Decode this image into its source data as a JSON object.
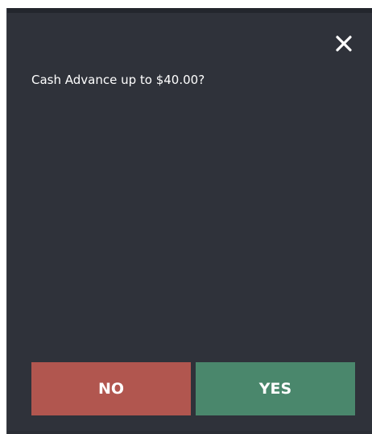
{
  "dialog": {
    "close_icon": "close-icon",
    "message": "Cash Advance up to $40.00?",
    "buttons": {
      "no_label": "NO",
      "yes_label": "YES"
    }
  },
  "colors": {
    "dialog_background": "#2f323a",
    "no_button": "#b1564f",
    "yes_button": "#4a876c",
    "text": "#ffffff"
  }
}
